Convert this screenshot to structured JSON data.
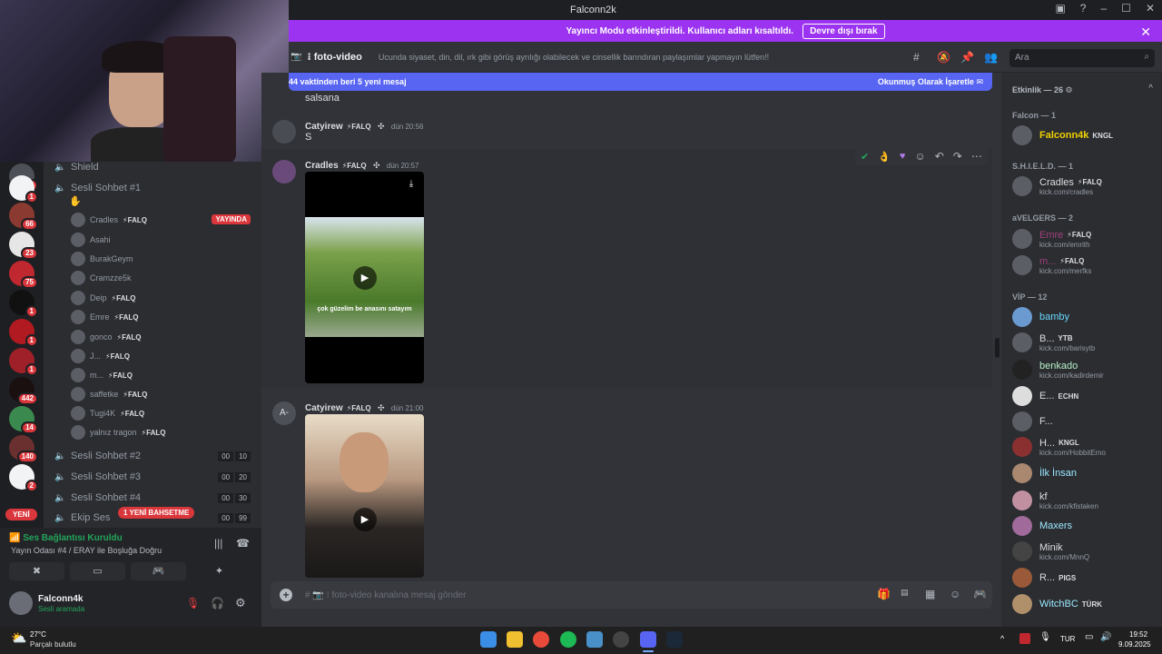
{
  "window": {
    "title": "Falconn2k"
  },
  "banner": {
    "text": "Yayıncı Modu etkinleştirildi. Kullanıcı adları kısaltıldı.",
    "button": "Devre dışı bırak"
  },
  "channel": {
    "name": "foto-video",
    "topic": "Ucunda siyaset, din, dil, ırk gibi görüş ayrılığı olabilecek ve cinsellik barındıran paylaşımlar yapmayın lütfen!!",
    "search_placeholder": "Ara"
  },
  "newbar": {
    "left": "44 vaktinden beri 5 yeni mesaj",
    "right": "Okunmuş Olarak İşaretle"
  },
  "messages": [
    {
      "text": "salsana"
    },
    {
      "author": "Catyirew",
      "tag": "⚡FALQ",
      "time": "dün 20:56",
      "text": "S"
    },
    {
      "author": "Cradles",
      "tag": "⚡FALQ",
      "time": "dün 20:57",
      "video_caption": "çok güzelim be anasını satayım"
    },
    {
      "author": "Catyirew",
      "tag": "⚡FALQ",
      "time": "dün 21:00",
      "avatar_text": "A-"
    }
  ],
  "composer": {
    "placeholder": "# 📷 ⁝ foto-video kanalına mesaj gönder"
  },
  "sidebar": {
    "channels": [
      {
        "label": "Shield"
      },
      {
        "label": "Sesli Sohbet #1"
      },
      {
        "label": "Sesli Sohbet #2",
        "counts": [
          "00",
          "10"
        ]
      },
      {
        "label": "Sesli Sohbet #3",
        "counts": [
          "00",
          "20"
        ]
      },
      {
        "label": "Sesli Sohbet #4",
        "counts": [
          "00",
          "30"
        ]
      },
      {
        "label": "Ekip Ses",
        "counts": [
          "00",
          "99"
        ]
      }
    ],
    "voice_users": [
      {
        "name": "Cradles",
        "tag": "⚡FALQ",
        "live": "YAYINDA"
      },
      {
        "name": "Asahi"
      },
      {
        "name": "BurakGeym"
      },
      {
        "name": "Cramzze5k"
      },
      {
        "name": "Deip",
        "tag": "⚡FALQ"
      },
      {
        "name": "Emre",
        "tag": "⚡FALQ"
      },
      {
        "name": "gonco",
        "tag": "⚡FALQ"
      },
      {
        "name": "J...",
        "tag": "⚡FALQ"
      },
      {
        "name": "m...",
        "tag": "⚡FALQ"
      },
      {
        "name": "saffetke",
        "tag": "⚡FALQ"
      },
      {
        "name": "Tugi4K",
        "tag": "⚡FALQ"
      },
      {
        "name": "yalnız tragon",
        "tag": "⚡FALQ"
      }
    ],
    "new_mentions": "1 YENİ BAHSETME",
    "new_label": "YENİ"
  },
  "servers": [
    {
      "badge": "27"
    },
    {
      "badge": "1"
    },
    {
      "badge": "66"
    },
    {
      "badge": "23"
    },
    {
      "badge": "75"
    },
    {
      "badge": "1"
    },
    {
      "badge": "1"
    },
    {
      "badge": "1"
    },
    {
      "badge": "442"
    },
    {
      "badge": "14"
    },
    {
      "badge": "140"
    },
    {
      "badge": "2"
    }
  ],
  "voice_panel": {
    "status": "Ses Bağlantısı Kuruldu",
    "channel": "Yayın Odası #4 / ERAY ile Boşluğa Doğru"
  },
  "user_panel": {
    "name": "Falconn4k",
    "status": "Sesli aramada"
  },
  "members": {
    "header": "Etkinlik — 26",
    "groups": [
      {
        "label": "Falcon — 1"
      },
      {
        "label": "S.H.I.E.L.D. — 1"
      },
      {
        "label": "aVELGERS — 2"
      },
      {
        "label": "VİP — 12"
      }
    ],
    "list": [
      {
        "name": "Falconn4k",
        "tag": "KNGL",
        "color": "#f0d000"
      },
      {
        "name": "Cradles",
        "tag": "⚡FALQ",
        "sub": "kick.com/cradles",
        "color": "#dbdee1"
      },
      {
        "name": "Emre",
        "tag": "⚡FALQ",
        "sub": "kick.com/emrith",
        "color": "#a0407a"
      },
      {
        "name": "m...",
        "tag": "⚡FALQ",
        "sub": "kick.com/merfks",
        "color": "#a0407a"
      },
      {
        "name": "bamby",
        "color": "#6ad8ff"
      },
      {
        "name": "B...",
        "tag": "YTB",
        "sub": "kick.com/barisytb",
        "color": "#dbdee1"
      },
      {
        "name": "benkado",
        "sub": "kick.com/kadirdemir",
        "color": "#b6f0c8"
      },
      {
        "name": "E...",
        "tag": "ECHN",
        "color": "#dbdee1"
      },
      {
        "name": "F...",
        "color": "#dbdee1"
      },
      {
        "name": "H...",
        "tag": "KNGL",
        "sub": "kick.com/HobbitEmo",
        "color": "#dbdee1"
      },
      {
        "name": "İlk İnsan",
        "color": "#9be8ff"
      },
      {
        "name": "kf",
        "sub": "kick.com/kfistaken",
        "color": "#dbdee1"
      },
      {
        "name": "Maxers",
        "color": "#9be8ff"
      },
      {
        "name": "Minik",
        "sub": "kick.com/MnnQ",
        "color": "#dbdee1"
      },
      {
        "name": "R...",
        "tag": "PIGS",
        "color": "#dbdee1"
      },
      {
        "name": "WitchBC",
        "tag": "TÜRK",
        "color": "#9be8ff"
      }
    ]
  },
  "taskbar": {
    "weather_temp": "27°C",
    "weather_desc": "Parçalı bulutlu",
    "lang": "TUR",
    "time": "19:52",
    "date": "9.09.2025"
  }
}
